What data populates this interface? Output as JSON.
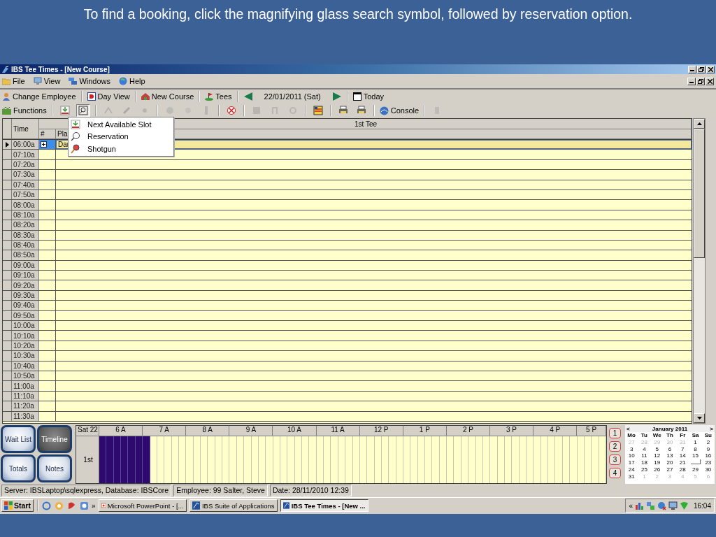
{
  "slide": {
    "caption": "To find a booking, click the magnifying glass search symbol, followed by reservation option."
  },
  "window": {
    "title": "IBS Tee Times - [New Course]"
  },
  "menu": [
    {
      "label": "File"
    },
    {
      "label": "View"
    },
    {
      "label": "Windows"
    },
    {
      "label": "Help"
    }
  ],
  "toolbar": [
    {
      "kind": "button",
      "label": "Change Employee"
    },
    {
      "kind": "separator"
    },
    {
      "kind": "button",
      "label": "Day View"
    },
    {
      "kind": "separator"
    },
    {
      "kind": "button",
      "label": "New Course"
    },
    {
      "kind": "separator"
    },
    {
      "kind": "button",
      "label": "Tees"
    },
    {
      "kind": "separator"
    },
    {
      "kind": "prev"
    },
    {
      "kind": "date",
      "label": "22/01/2011 (Sat)"
    },
    {
      "kind": "next"
    },
    {
      "kind": "separator"
    },
    {
      "kind": "button",
      "label": "Today"
    }
  ],
  "functions_bar": [
    {
      "kind": "button",
      "label": "Functions"
    },
    {
      "kind": "separator"
    },
    {
      "kind": "tool",
      "disabled": false,
      "pressed": false
    },
    {
      "kind": "tool",
      "disabled": false,
      "pressed": true
    },
    {
      "kind": "separator"
    },
    {
      "kind": "tool",
      "disabled": true,
      "pressed": false
    },
    {
      "kind": "tool",
      "disabled": true,
      "pressed": false
    },
    {
      "kind": "tool",
      "disabled": true,
      "pressed": false
    },
    {
      "kind": "separator"
    },
    {
      "kind": "tool",
      "disabled": true,
      "pressed": false
    },
    {
      "kind": "tool",
      "disabled": true,
      "pressed": false
    },
    {
      "kind": "tool",
      "disabled": true,
      "pressed": false
    },
    {
      "kind": "separator"
    },
    {
      "kind": "tool",
      "disabled": false,
      "pressed": false
    },
    {
      "kind": "separator"
    },
    {
      "kind": "tool",
      "disabled": true,
      "pressed": false
    },
    {
      "kind": "tool",
      "disabled": true,
      "pressed": false
    },
    {
      "kind": "tool",
      "disabled": true,
      "pressed": false
    },
    {
      "kind": "separator"
    },
    {
      "kind": "tool",
      "disabled": false,
      "pressed": false
    },
    {
      "kind": "separator"
    },
    {
      "kind": "tool",
      "disabled": false,
      "pressed": false
    },
    {
      "kind": "tool",
      "disabled": false,
      "pressed": false
    },
    {
      "kind": "separator"
    },
    {
      "kind": "button",
      "label": "Console"
    },
    {
      "kind": "separator"
    },
    {
      "kind": "tool",
      "disabled": true,
      "pressed": false
    }
  ],
  "popup_menu": [
    {
      "label": "Next Available Slot"
    },
    {
      "label": "Reservation"
    },
    {
      "label": "Shotgun"
    }
  ],
  "grid": {
    "columns": [
      "Time",
      "#",
      "Pla"
    ],
    "group_header": "1st Tee",
    "rows": [
      {
        "time": "06:00a",
        "selected": true,
        "expanded": false,
        "player": "Dar"
      },
      {
        "time": "07:10a",
        "selected": false
      },
      {
        "time": "07:20a",
        "selected": false
      },
      {
        "time": "07:30a",
        "selected": false
      },
      {
        "time": "07:40a",
        "selected": false
      },
      {
        "time": "07:50a",
        "selected": false
      },
      {
        "time": "08:00a",
        "selected": false
      },
      {
        "time": "08:10a",
        "selected": false
      },
      {
        "time": "08:20a",
        "selected": false
      },
      {
        "time": "08:30a",
        "selected": false
      },
      {
        "time": "08:40a",
        "selected": false
      },
      {
        "time": "08:50a",
        "selected": false
      },
      {
        "time": "09:00a",
        "selected": false
      },
      {
        "time": "09:10a",
        "selected": false
      },
      {
        "time": "09:20a",
        "selected": false
      },
      {
        "time": "09:30a",
        "selected": false
      },
      {
        "time": "09:40a",
        "selected": false
      },
      {
        "time": "09:50a",
        "selected": false
      },
      {
        "time": "10:00a",
        "selected": false
      },
      {
        "time": "10:10a",
        "selected": false
      },
      {
        "time": "10:20a",
        "selected": false
      },
      {
        "time": "10:30a",
        "selected": false
      },
      {
        "time": "10:40a",
        "selected": false
      },
      {
        "time": "10:50a",
        "selected": false
      },
      {
        "time": "11:00a",
        "selected": false
      },
      {
        "time": "11:10a",
        "selected": false
      },
      {
        "time": "11:20a",
        "selected": false
      },
      {
        "time": "11:30a",
        "selected": false
      }
    ]
  },
  "side_buttons": [
    {
      "label": "Wait List",
      "selected": false
    },
    {
      "label": "Timeline",
      "selected": true
    },
    {
      "label": "Totals",
      "selected": false
    },
    {
      "label": "Notes",
      "selected": false
    }
  ],
  "timeline": {
    "day": "Sat 22",
    "row_label": "1st",
    "hours": [
      {
        "label": "6 A",
        "slots": [
          true,
          true,
          true,
          true,
          true,
          true
        ]
      },
      {
        "label": "7 A",
        "slots": [
          true,
          false,
          false,
          false,
          false,
          false
        ]
      },
      {
        "label": "8 A",
        "slots": [
          false,
          false,
          false,
          false,
          false,
          false
        ]
      },
      {
        "label": "9 A",
        "slots": [
          false,
          false,
          false,
          false,
          false,
          false
        ]
      },
      {
        "label": "10 A",
        "slots": [
          false,
          false,
          false,
          false,
          false,
          false
        ]
      },
      {
        "label": "11 A",
        "slots": [
          false,
          false,
          false,
          false,
          false,
          false
        ]
      },
      {
        "label": "12 P",
        "slots": [
          false,
          false,
          false,
          false,
          false,
          false
        ]
      },
      {
        "label": "1 P",
        "slots": [
          false,
          false,
          false,
          false,
          false,
          false
        ]
      },
      {
        "label": "2 P",
        "slots": [
          false,
          false,
          false,
          false,
          false,
          false
        ]
      },
      {
        "label": "3 P",
        "slots": [
          false,
          false,
          false,
          false,
          false,
          false
        ]
      },
      {
        "label": "4 P",
        "slots": [
          false,
          false,
          false,
          false,
          false,
          false
        ]
      },
      {
        "label": "5 P",
        "slots": [
          false,
          false,
          false,
          false
        ]
      }
    ]
  },
  "page_buttons": [
    "1",
    "2",
    "3",
    "4"
  ],
  "calendar": {
    "month": "January 2011",
    "prev": "<",
    "next": ">",
    "weekdays": [
      "Mo",
      "Tu",
      "We",
      "Th",
      "Fr",
      "Sa",
      "Su"
    ],
    "weeks": [
      [
        {
          "day": "27",
          "other_month": true
        },
        {
          "day": "28",
          "other_month": true
        },
        {
          "day": "29",
          "other_month": true
        },
        {
          "day": "30",
          "other_month": true
        },
        {
          "day": "31",
          "other_month": true
        },
        {
          "day": "1",
          "other_month": false
        },
        {
          "day": "2",
          "other_month": false
        }
      ],
      [
        {
          "day": "3",
          "other_month": false
        },
        {
          "day": "4",
          "other_month": false
        },
        {
          "day": "5",
          "other_month": false
        },
        {
          "day": "6",
          "other_month": false
        },
        {
          "day": "7",
          "other_month": false
        },
        {
          "day": "8",
          "other_month": false
        },
        {
          "day": "9",
          "other_month": false
        }
      ],
      [
        {
          "day": "10",
          "other_month": false
        },
        {
          "day": "11",
          "other_month": false
        },
        {
          "day": "12",
          "other_month": false
        },
        {
          "day": "13",
          "other_month": false
        },
        {
          "day": "14",
          "other_month": false
        },
        {
          "day": "15",
          "other_month": false
        },
        {
          "day": "16",
          "other_month": false
        }
      ],
      [
        {
          "day": "17",
          "other_month": false
        },
        {
          "day": "18",
          "other_month": false
        },
        {
          "day": "19",
          "other_month": false
        },
        {
          "day": "20",
          "other_month": false
        },
        {
          "day": "21",
          "other_month": false
        },
        {
          "selected": true,
          "other_month": false
        },
        {
          "day": "23",
          "other_month": false
        }
      ],
      [
        {
          "day": "24",
          "other_month": false
        },
        {
          "day": "25",
          "other_month": false
        },
        {
          "day": "26",
          "other_month": false
        },
        {
          "day": "27",
          "other_month": false
        },
        {
          "day": "28",
          "other_month": false
        },
        {
          "day": "29",
          "other_month": false
        },
        {
          "day": "30",
          "other_month": false
        }
      ],
      [
        {
          "day": "31",
          "other_month": false
        },
        {
          "day": "1",
          "other_month": true
        },
        {
          "day": "2",
          "other_month": true
        },
        {
          "day": "3",
          "other_month": true
        },
        {
          "day": "4",
          "other_month": true
        },
        {
          "day": "5",
          "other_month": true
        },
        {
          "day": "6",
          "other_month": true
        }
      ]
    ]
  },
  "status": [
    "Server: IBSLaptop\\sqlexpress, Database: IBSCore",
    "Employee: 99 Salter, Steve",
    "Date: 28/11/2010 12:39"
  ],
  "taskbar": {
    "start": "Start",
    "more": "»",
    "tasks": [
      {
        "label": "Microsoft PowerPoint - [...",
        "selected": false
      },
      {
        "label": "IBS Suite of Applications",
        "selected": false
      },
      {
        "label": "IBS Tee Times - [New ...",
        "selected": true
      }
    ],
    "tray_more": "«",
    "clock": "16:04"
  }
}
